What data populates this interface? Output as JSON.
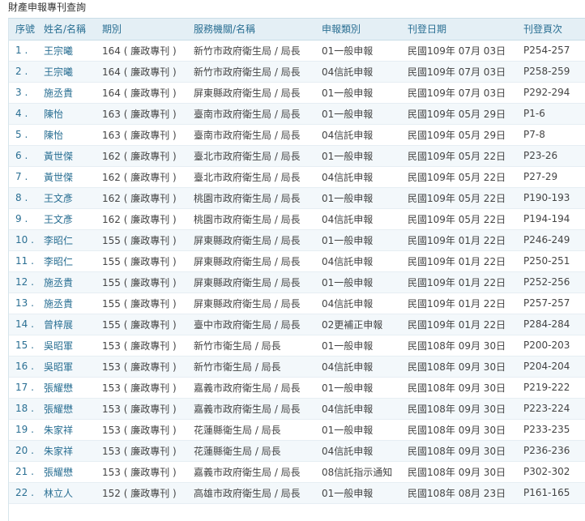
{
  "page": {
    "title": "財產申報專刊查詢"
  },
  "table": {
    "headers": [
      "序號",
      "姓名/名稱",
      "期別",
      "服務機關/名稱",
      "申報類別",
      "刊登日期",
      "刊登頁次"
    ],
    "rows": [
      {
        "idx": "1 .",
        "name": "王宗曦",
        "issue": "164 ( 廉政專刊 )",
        "org": "新竹市政府衛生局 / 局長",
        "type": "01一般申報",
        "date": "民國109年 07月 03日",
        "pages": "P254-257"
      },
      {
        "idx": "2 .",
        "name": "王宗曦",
        "issue": "164 ( 廉政專刊 )",
        "org": "新竹市政府衛生局 / 局長",
        "type": "04信託申報",
        "date": "民國109年 07月 03日",
        "pages": "P258-259"
      },
      {
        "idx": "3 .",
        "name": "施丞貴",
        "issue": "164 ( 廉政專刊 )",
        "org": "屏東縣政府衛生局 / 局長",
        "type": "01一般申報",
        "date": "民國109年 07月 03日",
        "pages": "P292-294"
      },
      {
        "idx": "4 .",
        "name": "陳怡",
        "issue": "163 ( 廉政專刊 )",
        "org": "臺南市政府衛生局 / 局長",
        "type": "01一般申報",
        "date": "民國109年 05月 29日",
        "pages": "P1-6"
      },
      {
        "idx": "5 .",
        "name": "陳怡",
        "issue": "163 ( 廉政專刊 )",
        "org": "臺南市政府衛生局 / 局長",
        "type": "04信託申報",
        "date": "民國109年 05月 29日",
        "pages": "P7-8"
      },
      {
        "idx": "6 .",
        "name": "黃世傑",
        "issue": "162 ( 廉政專刊 )",
        "org": "臺北市政府衛生局 / 局長",
        "type": "01一般申報",
        "date": "民國109年 05月 22日",
        "pages": "P23-26"
      },
      {
        "idx": "7 .",
        "name": "黃世傑",
        "issue": "162 ( 廉政專刊 )",
        "org": "臺北市政府衛生局 / 局長",
        "type": "04信託申報",
        "date": "民國109年 05月 22日",
        "pages": "P27-29"
      },
      {
        "idx": "8 .",
        "name": "王文彥",
        "issue": "162 ( 廉政專刊 )",
        "org": "桃園市政府衛生局 / 局長",
        "type": "01一般申報",
        "date": "民國109年 05月 22日",
        "pages": "P190-193"
      },
      {
        "idx": "9 .",
        "name": "王文彥",
        "issue": "162 ( 廉政專刊 )",
        "org": "桃園市政府衛生局 / 局長",
        "type": "04信託申報",
        "date": "民國109年 05月 22日",
        "pages": "P194-194"
      },
      {
        "idx": "10 .",
        "name": "李昭仁",
        "issue": "155 ( 廉政專刊 )",
        "org": "屏東縣政府衛生局 / 局長",
        "type": "01一般申報",
        "date": "民國109年 01月 22日",
        "pages": "P246-249"
      },
      {
        "idx": "11 .",
        "name": "李昭仁",
        "issue": "155 ( 廉政專刊 )",
        "org": "屏東縣政府衛生局 / 局長",
        "type": "04信託申報",
        "date": "民國109年 01月 22日",
        "pages": "P250-251"
      },
      {
        "idx": "12 .",
        "name": "施丞貴",
        "issue": "155 ( 廉政專刊 )",
        "org": "屏東縣政府衛生局 / 局長",
        "type": "01一般申報",
        "date": "民國109年 01月 22日",
        "pages": "P252-256"
      },
      {
        "idx": "13 .",
        "name": "施丞貴",
        "issue": "155 ( 廉政專刊 )",
        "org": "屏東縣政府衛生局 / 局長",
        "type": "04信託申報",
        "date": "民國109年 01月 22日",
        "pages": "P257-257"
      },
      {
        "idx": "14 .",
        "name": "曾梓展",
        "issue": "155 ( 廉政專刊 )",
        "org": "臺中市政府衛生局 / 局長",
        "type": "02更補正申報",
        "date": "民國109年 01月 22日",
        "pages": "P284-284"
      },
      {
        "idx": "15 .",
        "name": "吳昭軍",
        "issue": "153 ( 廉政專刊 )",
        "org": "新竹市衛生局 / 局長",
        "type": "01一般申報",
        "date": "民國108年 09月 30日",
        "pages": "P200-203"
      },
      {
        "idx": "16 .",
        "name": "吳昭軍",
        "issue": "153 ( 廉政專刊 )",
        "org": "新竹市衛生局 / 局長",
        "type": "04信託申報",
        "date": "民國108年 09月 30日",
        "pages": "P204-204"
      },
      {
        "idx": "17 .",
        "name": "張耀懋",
        "issue": "153 ( 廉政專刊 )",
        "org": "嘉義市政府衛生局 / 局長",
        "type": "01一般申報",
        "date": "民國108年 09月 30日",
        "pages": "P219-222"
      },
      {
        "idx": "18 .",
        "name": "張耀懋",
        "issue": "153 ( 廉政專刊 )",
        "org": "嘉義市政府衛生局 / 局長",
        "type": "04信託申報",
        "date": "民國108年 09月 30日",
        "pages": "P223-224"
      },
      {
        "idx": "19 .",
        "name": "朱家祥",
        "issue": "153 ( 廉政專刊 )",
        "org": "花蓮縣衛生局 / 局長",
        "type": "01一般申報",
        "date": "民國108年 09月 30日",
        "pages": "P233-235"
      },
      {
        "idx": "20 .",
        "name": "朱家祥",
        "issue": "153 ( 廉政專刊 )",
        "org": "花蓮縣衛生局 / 局長",
        "type": "04信託申報",
        "date": "民國108年 09月 30日",
        "pages": "P236-236"
      },
      {
        "idx": "21 .",
        "name": "張耀懋",
        "issue": "153 ( 廉政專刊 )",
        "org": "嘉義市政府衛生局 / 局長",
        "type": "08信託指示通知",
        "date": "民國108年 09月 30日",
        "pages": "P302-302"
      },
      {
        "idx": "22 .",
        "name": "林立人",
        "issue": "152 ( 廉政專刊 )",
        "org": "高雄市政府衛生局 / 局長",
        "type": "01一般申報",
        "date": "民國108年 08月 23日",
        "pages": "P161-165"
      }
    ]
  }
}
